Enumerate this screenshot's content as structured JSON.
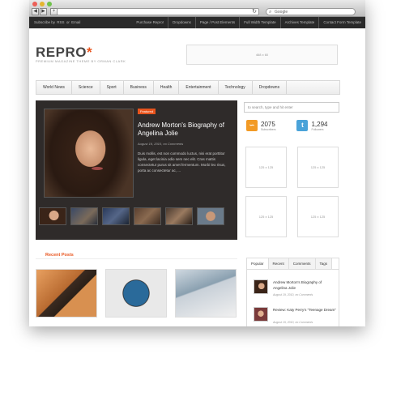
{
  "browser": {
    "nav_back": "◀",
    "nav_fwd": "▶",
    "nav_plus": "+",
    "refresh": "↻",
    "search_placeholder": "Google",
    "colors": {
      "close": "#ec5f57",
      "min": "#e4b52f",
      "max": "#6fc24a"
    }
  },
  "topbar": {
    "left": [
      "Subscribe by",
      "RSS",
      "or",
      "Email"
    ],
    "links": [
      "Purchase Repro!",
      "Dropdowns",
      "Page / Post Elements",
      "Full Width Template",
      "Archives Template",
      "Contact Form Template"
    ]
  },
  "header": {
    "logo": "REPRO",
    "logo_star": "*",
    "tagline": "PREMIUM MAGAZINE THEME BY ORMAN CLARK",
    "ad": "468 x 60"
  },
  "nav": [
    "World News",
    "Science",
    "Sport",
    "Business",
    "Health",
    "Entertainment",
    "Technology",
    "Dropdowns"
  ],
  "featured": {
    "badge": "Featured",
    "title": "Andrew Morton's Biography of Angelina Jolie",
    "date": "August 19, 2010, no Comments",
    "excerpt": "Duis mollis, est non commodo luctus, nisi erat porttitor ligula, eget lacinia odio sem nec elit. Cras mattis consectetur purus sit amet fermentum. Morbi leo risus, porta ac consectetur ac, ...",
    "thumb_count": 6
  },
  "sidebar": {
    "search_placeholder": "to search, type and hit enter",
    "subscribers_count": "2075",
    "subscribers_label": "Subscribers",
    "followers_count": "1,294",
    "followers_label": "Followers",
    "ads": [
      "125 x 125",
      "125 x 125",
      "125 x 125",
      "125 x 125"
    ]
  },
  "recent": {
    "title": "Recent Posts"
  },
  "tabs": {
    "labels": [
      "Popular",
      "Recent",
      "Comments",
      "Tags"
    ],
    "items": [
      {
        "title": "Andrew Morton's Biography of Angelina Jolie",
        "date": "August 19, 2010, no Comments"
      },
      {
        "title": "Review: Katy Perry's \"Teenage Dream\"",
        "date": "August 19, 2010, no Comments"
      }
    ]
  },
  "colors": {
    "accent": "#e8541d",
    "dark": "#2f2b2a",
    "rss": "#f29a25",
    "twitter": "#4aa3d9"
  }
}
